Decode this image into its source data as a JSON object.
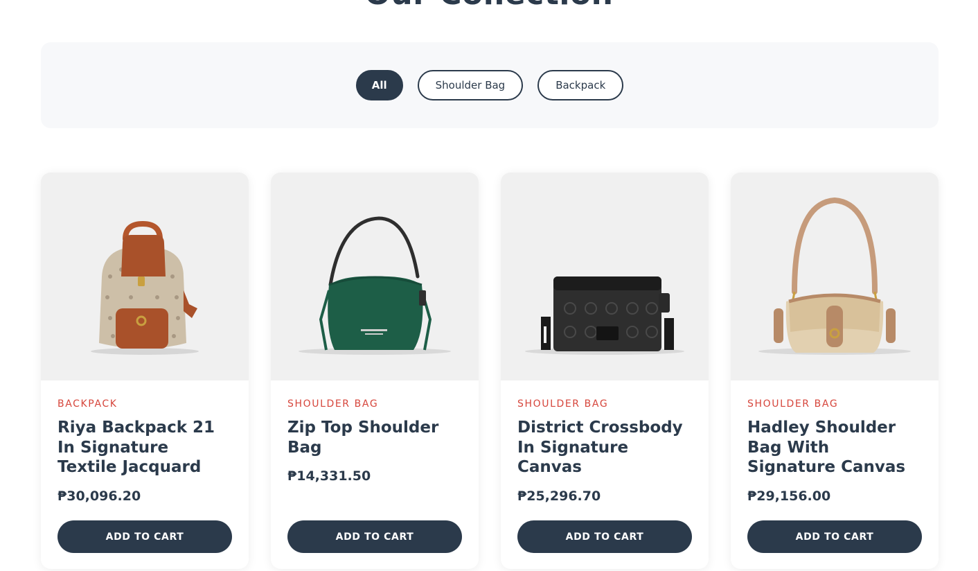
{
  "section": {
    "title": "Our Collection"
  },
  "filters": [
    {
      "label": "All"
    },
    {
      "label": "Shoulder Bag"
    },
    {
      "label": "Backpack"
    }
  ],
  "products": [
    {
      "category": "BACKPACK",
      "name": "Riya Backpack 21 In Signature Textile Jacquard",
      "price": "₱30,096.20",
      "button": "ADD TO CART",
      "image_icon": "backpack-icon"
    },
    {
      "category": "SHOULDER BAG",
      "name": "Zip Top Shoulder Bag",
      "price": "₱14,331.50",
      "button": "ADD TO CART",
      "image_icon": "green-shoulder-bag-icon"
    },
    {
      "category": "SHOULDER BAG",
      "name": "District Crossbody In Signature Canvas",
      "price": "₱25,296.70",
      "button": "ADD TO CART",
      "image_icon": "black-crossbody-bag-icon"
    },
    {
      "category": "SHOULDER BAG",
      "name": "Hadley Shoulder Bag With Signature Canvas",
      "price": "₱29,156.00",
      "button": "ADD TO CART",
      "image_icon": "beige-shoulder-bag-icon"
    }
  ],
  "colors": {
    "primary": "#2b3a4b",
    "accent": "#d6453b",
    "filter_bg": "#f7f8fa",
    "image_bg": "#f0f0f0"
  }
}
